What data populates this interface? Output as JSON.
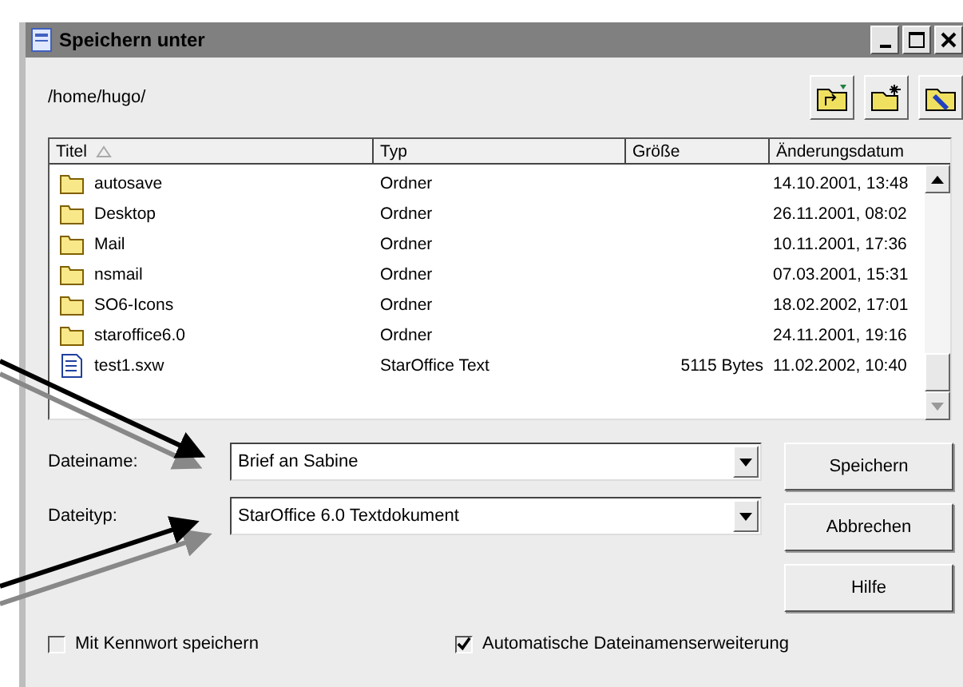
{
  "window": {
    "title": "Speichern unter"
  },
  "path": "/home/hugo/",
  "table": {
    "columns": [
      {
        "label": "Titel",
        "sorted": true
      },
      {
        "label": "Typ",
        "sorted": false
      },
      {
        "label": "Größe",
        "sorted": false
      },
      {
        "label": "Änderungsdatum",
        "sorted": false
      }
    ],
    "rows": [
      {
        "kind": "folder",
        "name": "autosave",
        "type": "Ordner",
        "date": "14.10.2001, 13:48"
      },
      {
        "kind": "folder",
        "name": "Desktop",
        "type": "Ordner",
        "date": "26.11.2001, 08:02"
      },
      {
        "kind": "folder",
        "name": "Mail",
        "type": "Ordner",
        "date": "10.11.2001, 17:36"
      },
      {
        "kind": "folder",
        "name": "nsmail",
        "type": "Ordner",
        "date": "07.03.2001, 15:31"
      },
      {
        "kind": "folder",
        "name": "SO6-Icons",
        "type": "Ordner",
        "date": "18.02.2002, 17:01"
      },
      {
        "kind": "folder",
        "name": "staroffice6.0",
        "type": "Ordner",
        "date": "24.11.2001, 19:16"
      },
      {
        "kind": "document",
        "name": "test1.sxw",
        "type": "StarOffice Text",
        "size": "5115 Bytes",
        "date": "11.02.2002, 10:40"
      }
    ]
  },
  "fields": [
    {
      "label": "Dateiname:",
      "value": "Brief an Sabine"
    },
    {
      "label": "Dateityp:",
      "value": "StarOffice 6.0 Textdokument"
    }
  ],
  "buttons": [
    "Speichern",
    "Abbrechen",
    "Hilfe"
  ],
  "options": [
    {
      "label": "Mit Kennwort speichern",
      "checked": false
    },
    {
      "label": "Automatische Dateinamenserweiterung",
      "checked": true
    }
  ]
}
